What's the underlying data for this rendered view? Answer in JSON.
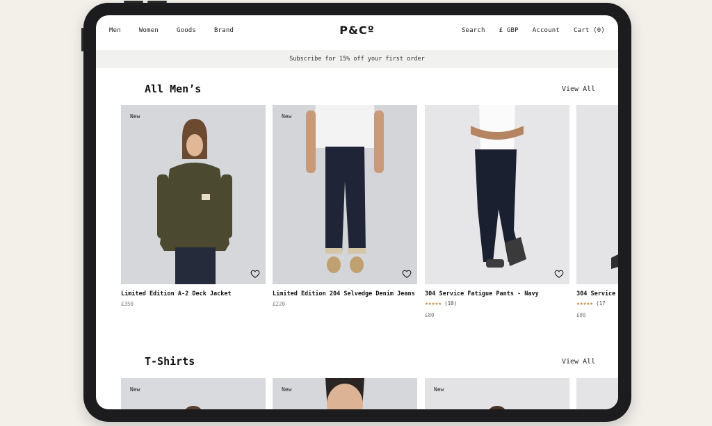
{
  "nav": {
    "left": [
      "Men",
      "Women",
      "Goods",
      "Brand"
    ],
    "logo": "P&Cº",
    "right": [
      "Search",
      "£ GBP",
      "Account",
      "Cart (0)"
    ]
  },
  "banner": "Subscribe for 15% off your first order",
  "sections": [
    {
      "title": "All Men’s",
      "view_all": "View All",
      "products": [
        {
          "badge": "New",
          "name": "Limited Edition A-2 Deck Jacket",
          "price": "£350"
        },
        {
          "badge": "New",
          "name": "Limited Edition 204 Selvedge Denim Jeans",
          "price": "£220"
        },
        {
          "badge": "",
          "name": "304 Service Fatigue Pants - Navy",
          "stars": "★★★★★",
          "reviews": "(10)",
          "price": "£80"
        },
        {
          "badge": "",
          "name": "304 Service ",
          "stars": "★★★★★",
          "reviews": "(17",
          "price": "£80"
        }
      ]
    },
    {
      "title": "T-Shirts",
      "view_all": "View All",
      "products": [
        {
          "badge": "New"
        },
        {
          "badge": "New"
        },
        {
          "badge": "New"
        }
      ]
    }
  ],
  "icons": {
    "wishlist": "heart-outline-icon",
    "rating": "star-icon"
  },
  "colors": {
    "accent_star": "#b9893a",
    "banner_bg": "#f1f1f0",
    "device": "#1c1c1e"
  }
}
